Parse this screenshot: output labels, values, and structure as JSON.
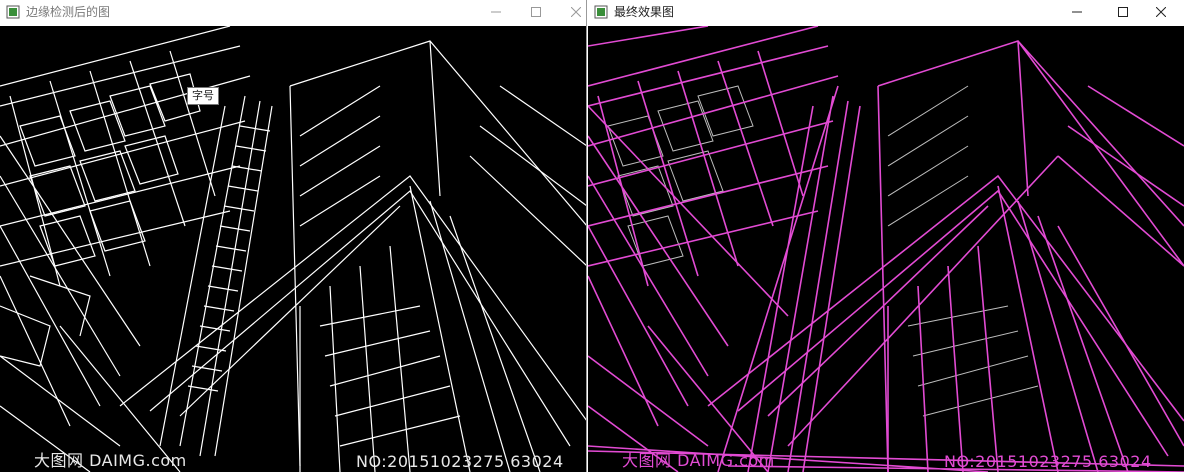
{
  "left_window": {
    "title": "边缘检测后的图",
    "tooltip": "字号",
    "watermark_left": "大图网 DAIMG.com",
    "watermark_right": "NO:20151023275 63024"
  },
  "right_window": {
    "title": "最终效果图",
    "watermark_left": "大图网 DAIMG.com",
    "watermark_right": "NO:20151023275 63024"
  },
  "colors": {
    "edge": "#ffffff",
    "hough_line": "#e24bd3",
    "background": "#000000"
  },
  "icons": {
    "app": "opencv-window-icon",
    "minimize": "minimize-icon",
    "maximize": "maximize-icon",
    "close": "close-icon"
  }
}
